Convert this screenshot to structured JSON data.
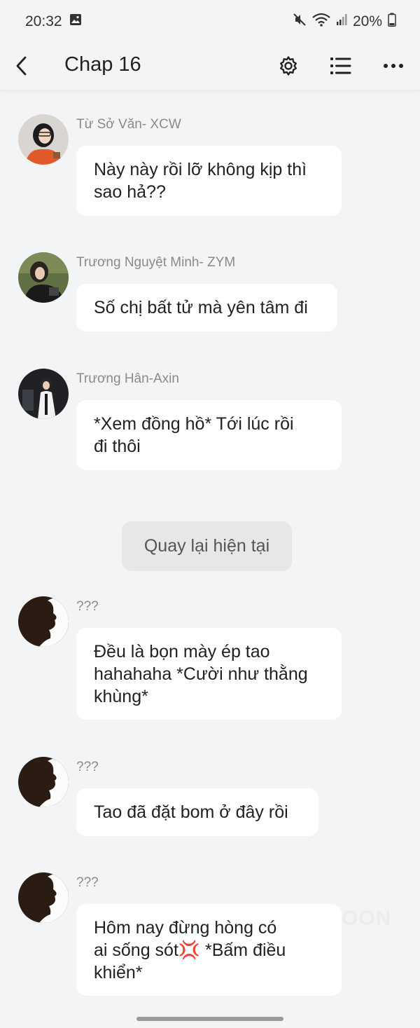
{
  "status_bar": {
    "time": "20:32",
    "battery": "20%"
  },
  "app_bar": {
    "title": "Chap 16"
  },
  "messages": [
    {
      "sender": "Từ Sở Văn- XCW",
      "text": "Này này rồi lỡ không kịp thì\nsao hả??"
    },
    {
      "sender": "Trương Nguyệt Minh- ZYM",
      "text": "Số chị bất tử mà yên tâm đi"
    },
    {
      "sender": "Trương Hân-Axin",
      "text": "*Xem đồng hồ* Tới lúc rồi\nđi thôi"
    },
    {
      "sender": "???",
      "text": "Đều là bọn mày ép tao\nhahahaha *Cười như thằng\nkhùng*"
    },
    {
      "sender": "???",
      "text": "Tao đã đặt bom ở đây rồi"
    },
    {
      "sender": "???",
      "text": "Hôm nay đừng hòng có\nai sống sót💢 *Bấm điều\nkhiển*"
    }
  ],
  "return_button": {
    "label": "Quay lại hiện tại"
  },
  "watermark": "OON"
}
